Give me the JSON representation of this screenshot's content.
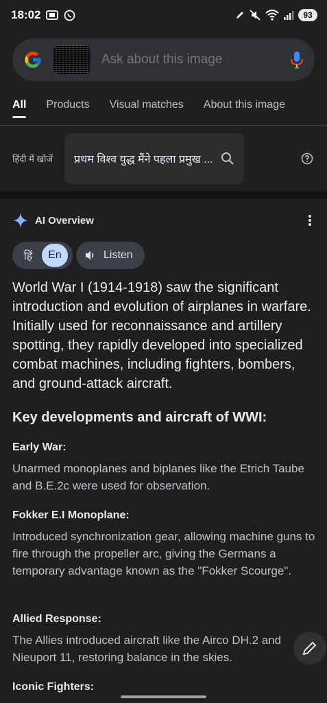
{
  "status": {
    "time": "18:02",
    "battery": "93"
  },
  "search": {
    "placeholder": "Ask about this image"
  },
  "tabs": [
    {
      "label": "All",
      "active": true
    },
    {
      "label": "Products",
      "active": false
    },
    {
      "label": "Visual matches",
      "active": false
    },
    {
      "label": "About this image",
      "active": false
    }
  ],
  "hindi": {
    "label": "हिंदी में खोजें",
    "query": "प्रथम विश्व युद्ध मैंने पहला प्रमुख ..."
  },
  "ai": {
    "title": "AI Overview",
    "lang_hi": "हिं",
    "lang_en": "En",
    "listen": "Listen",
    "summary": "World War I (1914-1918) saw the significant introduction and evolution of airplanes in warfare. Initially used for reconnaissance and artillery spotting, they rapidly developed into specialized combat machines, including fighters, bombers, and ground-attack aircraft.",
    "key_heading": "Key developments and aircraft of WWI:",
    "sections": [
      {
        "title": "Early War:",
        "body": "Unarmed monoplanes and biplanes like the Etrich Taube and B.E.2c were used for observation."
      },
      {
        "title": "Fokker E.I Monoplane:",
        "body": "Introduced synchronization gear, allowing machine guns to fire through the propeller arc, giving the Germans a temporary advantage known as the \"Fokker Scourge\"."
      },
      {
        "title": "Allied Response:",
        "body": "The Allies introduced aircraft like the Airco DH.2 and Nieuport 11, restoring balance in the skies."
      },
      {
        "title": "Iconic Fighters:",
        "body": ""
      }
    ]
  },
  "colors": {
    "background": "#1f1f1f",
    "accent_blue": "#8ab4f8",
    "toggle_active": "#c2d8fb"
  },
  "icons": [
    "camera-icon",
    "whatsapp-icon",
    "edit-icon",
    "mute-icon",
    "wifi-icon",
    "signal-icon",
    "google-logo",
    "mic-icon",
    "search-icon",
    "help-icon",
    "sparkle-icon",
    "more-vert-icon",
    "volume-icon",
    "pencil-icon"
  ]
}
